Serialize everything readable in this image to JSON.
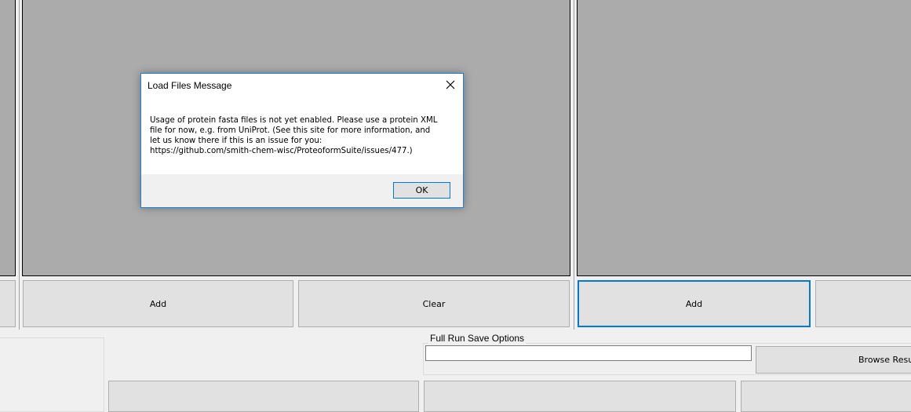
{
  "buttons": {
    "add_left": "Add",
    "clear_middle": "Clear",
    "add_right": "Add"
  },
  "save_options": {
    "label": "Full Run Save Options",
    "path_value": "",
    "browse_label": "Browse Result"
  },
  "dialog": {
    "title": "Load Files Message",
    "message": "Usage of protein fasta files is not yet enabled. Please use a protein XML\nfile for now, e.g. from UniProt. (See this site for more information, and\nlet us know there if this is an issue for you:\nhttps://github.com/smith-chem-wisc/ProteoformSuite/issues/477.)",
    "ok_label": "OK",
    "close_icon": "close-icon"
  }
}
